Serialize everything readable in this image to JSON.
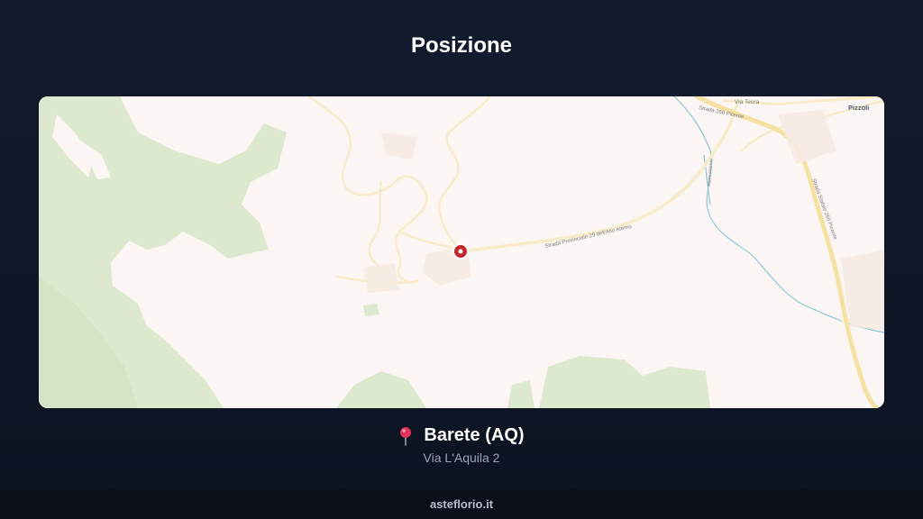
{
  "header": {
    "title": "Posizione"
  },
  "map": {
    "road_labels": [
      "Via Teora",
      "Strada 260 Picente",
      "Strada Provinciale 29 dell'Alto Aterno",
      "Strada Statale 260 Picente",
      "Aterno/Aterno"
    ],
    "place_labels": [
      "Pizzoli"
    ],
    "marker_icon": "map-marker-icon",
    "colors": {
      "land": "#fbf6f3",
      "forest": "#dde9cf",
      "road": "#f7ecc9",
      "highway": "#f5e2a3",
      "river": "#8ec7d6",
      "marker": "#c1272d"
    }
  },
  "location": {
    "pin_icon": "round-pushpin-icon",
    "name": "Barete (AQ)",
    "address": "Via L'Aquila 2"
  },
  "footer": {
    "site": "asteflorio.it"
  }
}
